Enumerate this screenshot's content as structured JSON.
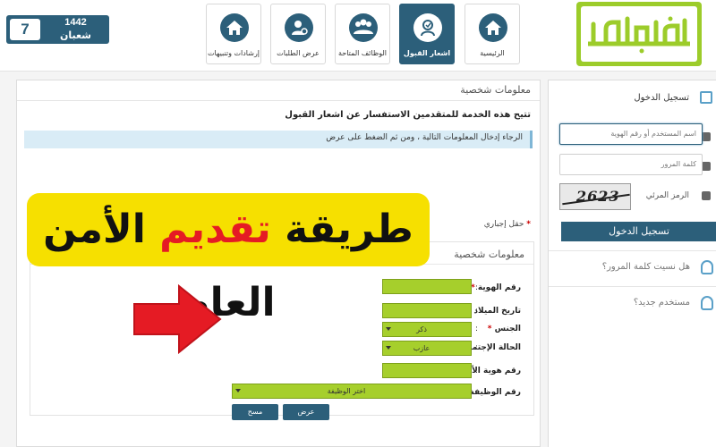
{
  "header": {
    "date": {
      "day": "7",
      "year": "1442",
      "month": "شعبان"
    },
    "nav": [
      {
        "label": "الرئيسية",
        "icon": "home-icon",
        "active": false
      },
      {
        "label": "اشعار القبول",
        "icon": "acceptance-icon",
        "active": true
      },
      {
        "label": "الوظائف المتاحة",
        "icon": "people-icon",
        "active": false
      },
      {
        "label": "عرض الطلبات",
        "icon": "user-requests-icon",
        "active": false
      },
      {
        "label": "إرشادات وتنبيهات",
        "icon": "home-icon",
        "active": false
      }
    ],
    "logo": "logo"
  },
  "main": {
    "title": "معلومات شخصية",
    "description": "تتيح هذه الخدمة للمتقدمين الاستفسار عن اشعار القبول",
    "info": "الرجاء إدخال المعلومات التالية ، ومن ثم الضغط على عرض",
    "required_note": "حقل إجباري",
    "required_star": "*",
    "form": {
      "title": "معلومات شخصية",
      "fields": {
        "id_number": {
          "label": "رقم الهوية",
          "value": ""
        },
        "birth_date": {
          "label": "تاريخ الميلاد",
          "value": ""
        },
        "gender": {
          "label": "الجنس",
          "value": "ذكر"
        },
        "marital_status": {
          "label": "الحالة الإجتماعية",
          "value": "عازب"
        },
        "father_id": {
          "label": "رقم هوية الأب",
          "value": ""
        },
        "job_number": {
          "label": "رقم الوظيفة",
          "value": "اختر الوظيفة"
        }
      },
      "buttons": {
        "show": "عرض",
        "clear": "مسح"
      }
    }
  },
  "login": {
    "title": "تسجيل الدخول",
    "username_placeholder": "اسم المستخدم أو رقم الهوية",
    "password_placeholder": "كلمة المرور",
    "captcha_label": "الرمز المرئي",
    "captcha_text": "2623",
    "button": "تسجيل الدخول",
    "forgot_password": "هل نسيت كلمة المرور؟",
    "new_user": "مستخدم جديد؟"
  },
  "banner": {
    "part1": "طريقة",
    "part2": "تقديم",
    "part3": "الأمن العام"
  },
  "colors": {
    "primary": "#2c5f7a",
    "field_green": "#a6cf2c",
    "banner_yellow": "#f6e000",
    "banner_red": "#e51b24",
    "arrow_red": "#e51b24",
    "logo_green": "#9ccc2a"
  }
}
